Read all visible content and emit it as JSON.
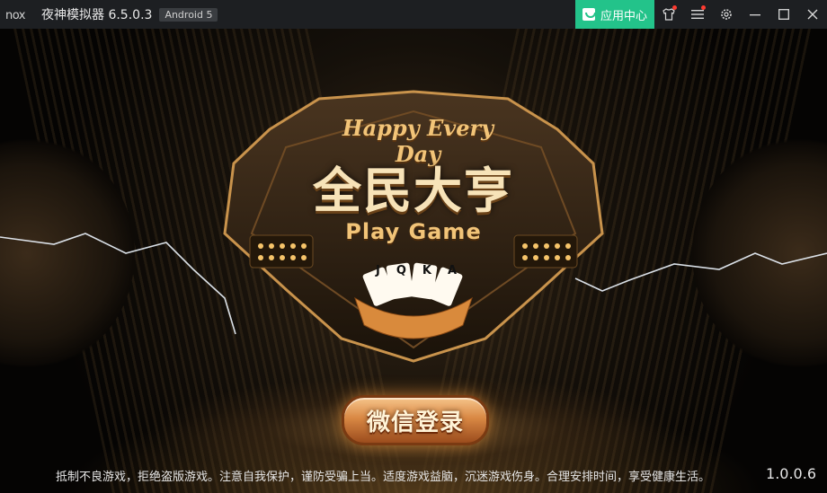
{
  "titlebar": {
    "app_name": "夜神模拟器 6.5.0.3",
    "android_badge": "Android 5",
    "app_center_label": "应用中心"
  },
  "icons": {
    "logo": "nox-logo",
    "app_center": "shopping-bag-icon",
    "skin": "shirt-icon",
    "menu": "menu-icon",
    "settings": "gear-icon",
    "minimize": "minimize-icon",
    "maximize": "maximize-icon",
    "close": "close-icon"
  },
  "colors": {
    "accent_green": "#23c38a",
    "notification_red": "#ff3b30",
    "gold": "#e8b15a"
  },
  "game": {
    "slogan": "Happy Every Day",
    "title": "全民大亨",
    "subtitle": "Play Game",
    "cards": [
      "J",
      "Q",
      "K",
      "A"
    ],
    "login_button": "微信登录",
    "notice": "抵制不良游戏，拒绝盗版游戏。注意自我保护，谨防受骗上当。适度游戏益脑，沉迷游戏伤身。合理安排时间，享受健康生活。",
    "version": "1.0.0.6"
  }
}
